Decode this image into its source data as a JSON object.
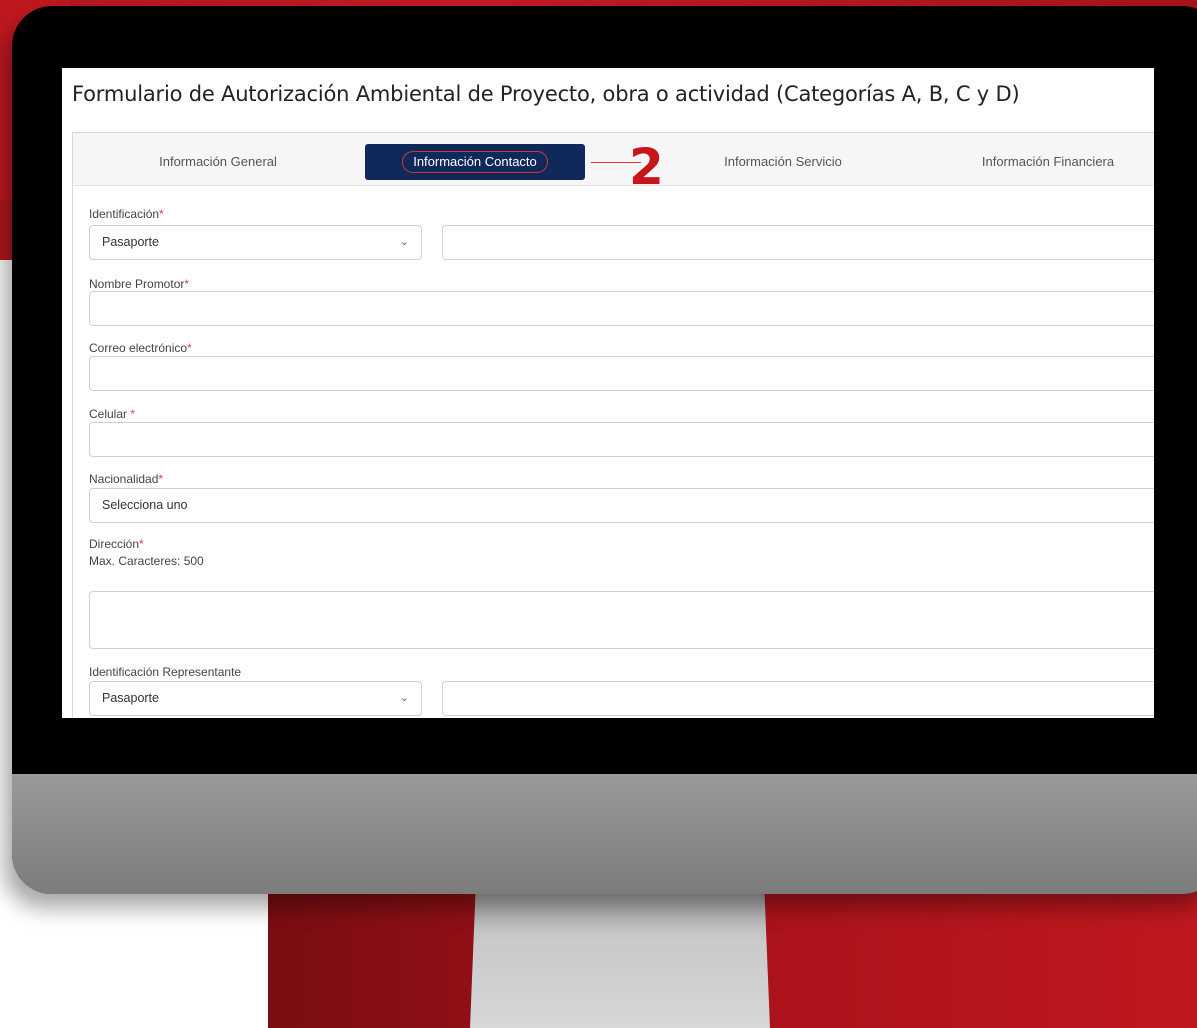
{
  "form": {
    "title": "Formulario de Autorización Ambiental de Proyecto, obra o actividad (Categorías A, B, C y D)",
    "tabs": [
      {
        "label": "Información General",
        "active": false
      },
      {
        "label": "Información Contacto",
        "active": true
      },
      {
        "label": "Información Servicio",
        "active": false
      },
      {
        "label": "Información Financiera",
        "active": false
      }
    ],
    "callout_number": "2",
    "required_mark": "*",
    "fields": {
      "identificacion": {
        "label": "Identificación",
        "type_value": "Pasaporte",
        "value": ""
      },
      "nombre_promotor": {
        "label": "Nombre Promotor",
        "value": ""
      },
      "correo": {
        "label": "Correo electrónico",
        "value": ""
      },
      "celular": {
        "label": "Celular ",
        "value": ""
      },
      "nacionalidad": {
        "label": "Nacionalidad",
        "value": "Selecciona uno"
      },
      "direccion": {
        "label": "Dirección",
        "hint": "Max. Caracteres: 500",
        "value": ""
      },
      "identificacion_representante": {
        "label": "Identificación Representante",
        "type_value": "Pasaporte",
        "value": ""
      }
    }
  },
  "colors": {
    "active_tab": "#0f2a5a",
    "accent_red": "#c8141c",
    "required": "#dd4444"
  },
  "icons": {
    "select_chevron": "chevron-down-icon"
  }
}
